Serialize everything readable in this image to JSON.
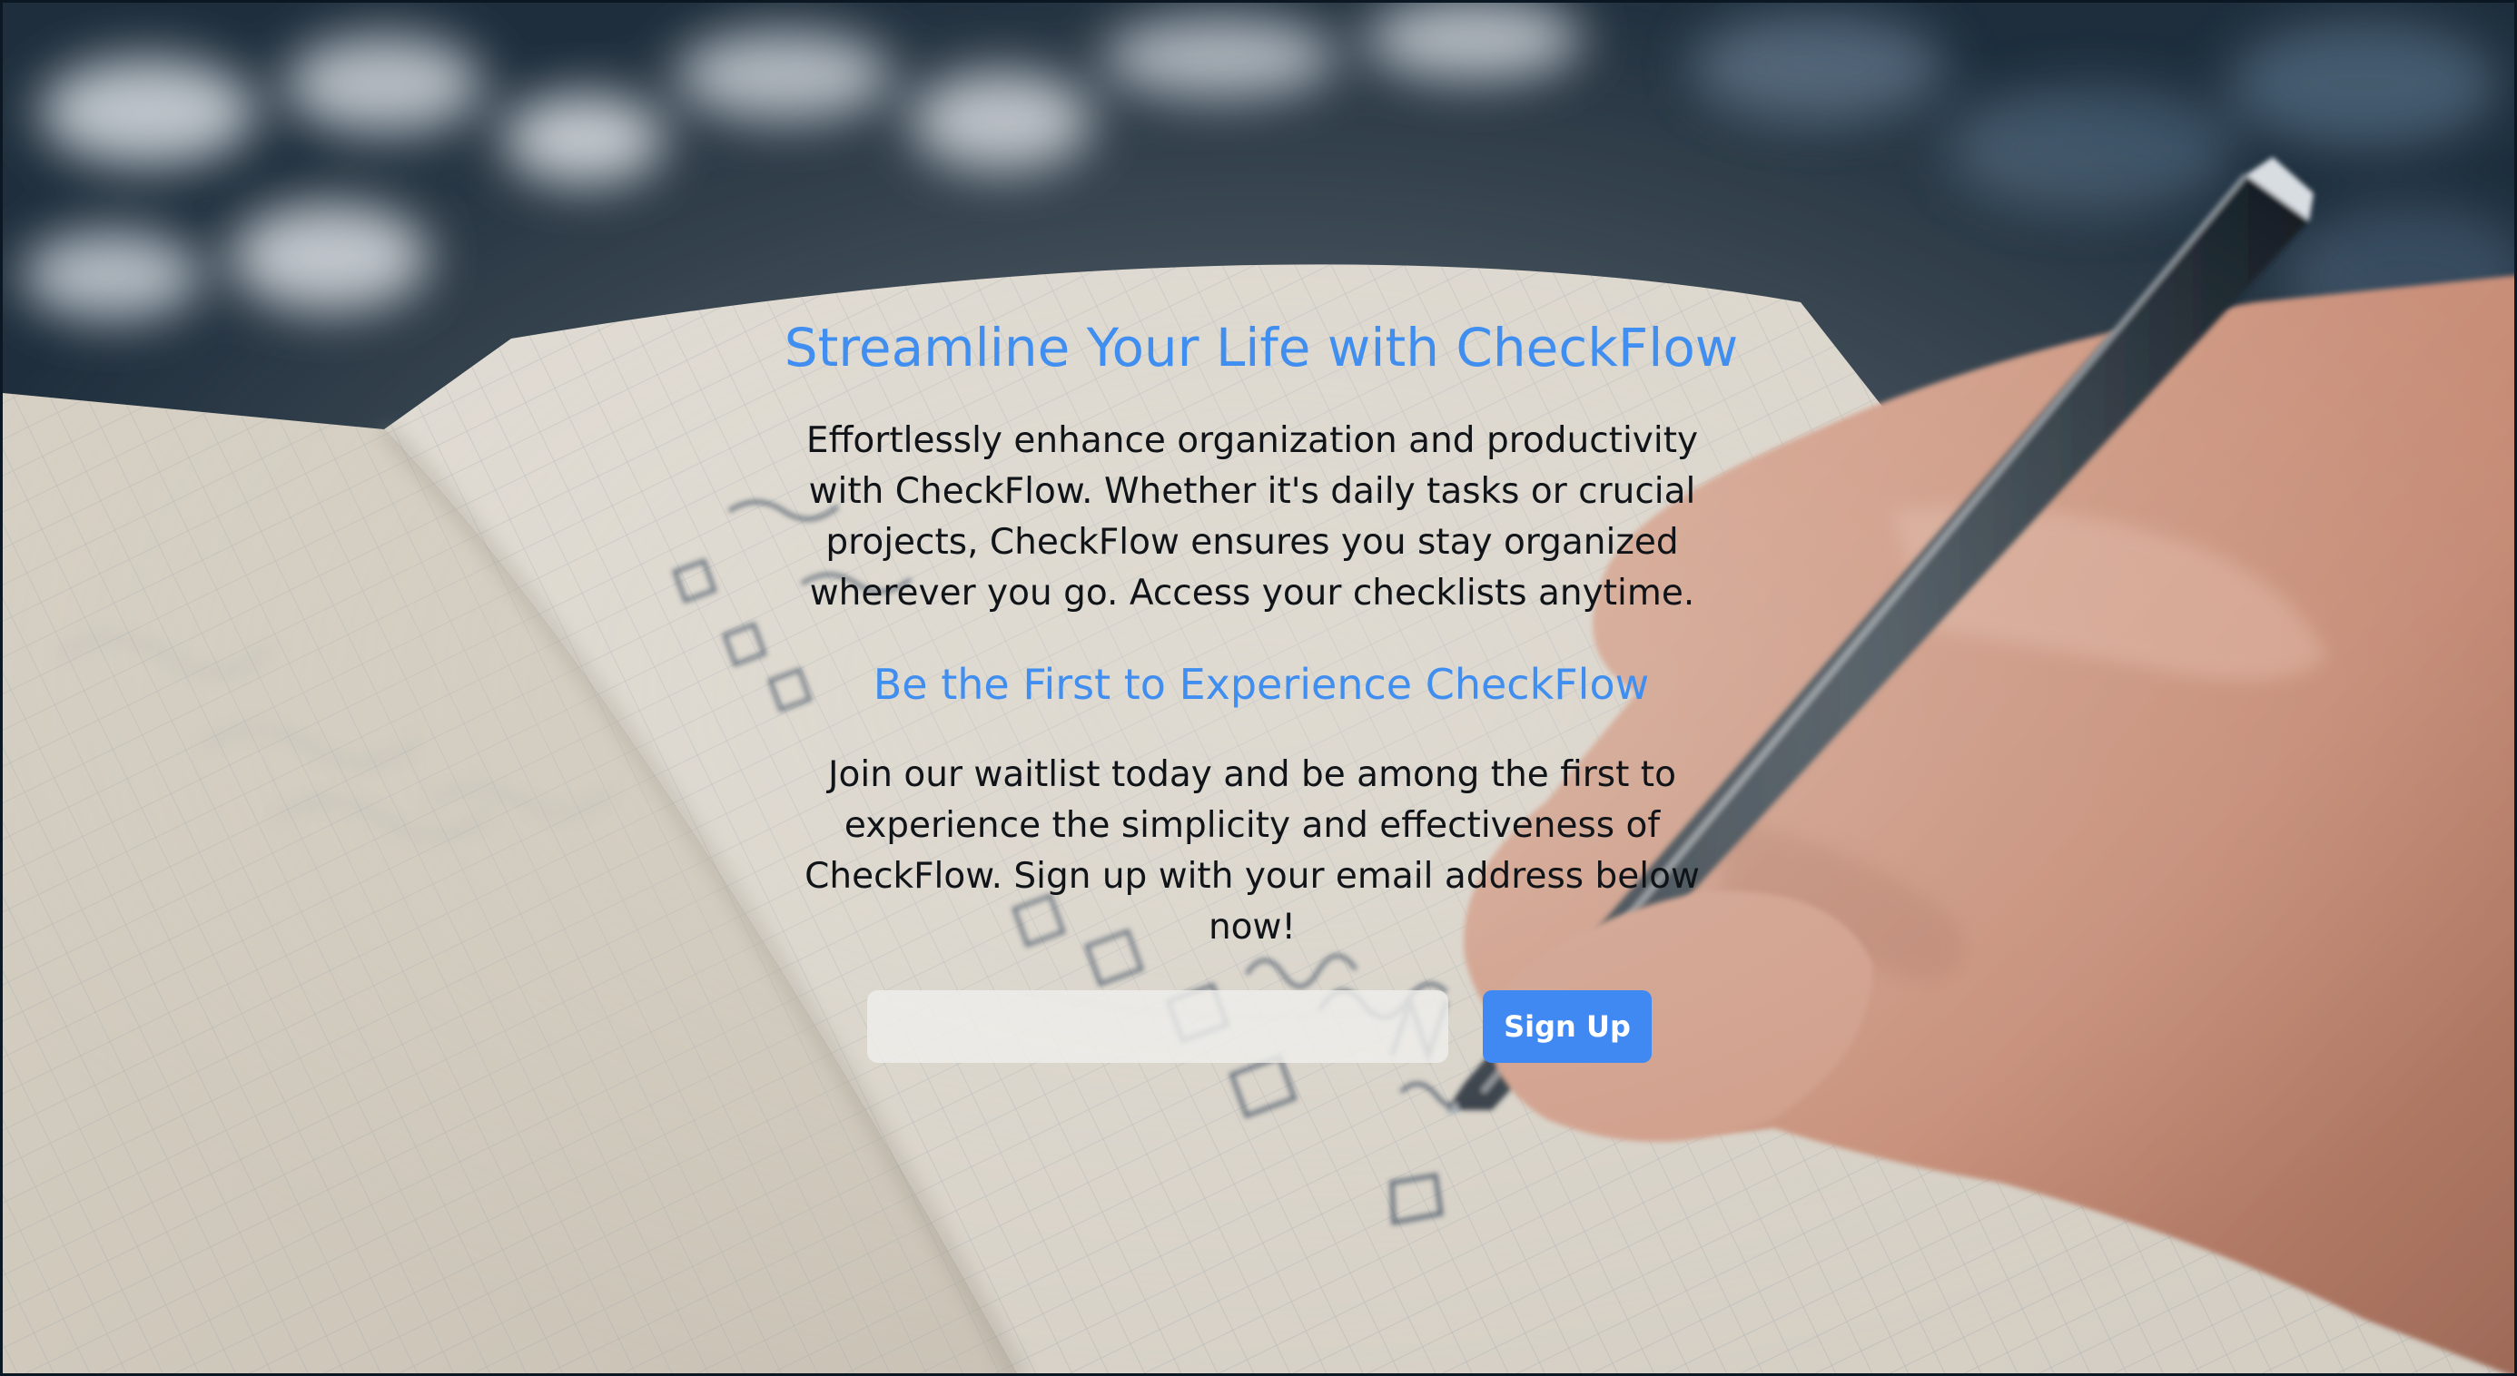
{
  "hero": {
    "headline": "Streamline Your Life with CheckFlow",
    "intro": "Effortlessly enhance organization and productivity with CheckFlow. Whether it's daily tasks or crucial projects, CheckFlow ensures you stay organized wherever you go. Access your checklists anytime.",
    "subheadline": "Be the First to Experience CheckFlow",
    "waitlist_text": "Join our waitlist today and be among the first to experience the simplicity and effectiveness of CheckFlow. Sign up with your email address below now!"
  },
  "signup": {
    "email_value": "",
    "email_placeholder": "",
    "button_label": "Sign Up"
  },
  "background": {
    "image": "notebook-checklist-with-pen-photo"
  },
  "colors": {
    "accent": "#3f8ef0",
    "button": "#4189f2",
    "text": "#101418"
  }
}
